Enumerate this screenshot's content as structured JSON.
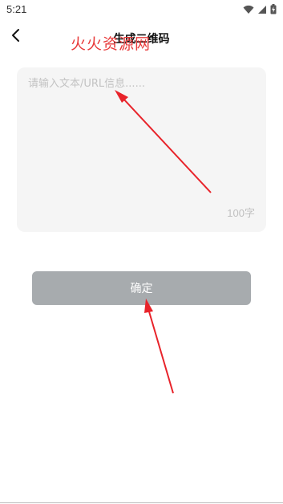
{
  "status_bar": {
    "time": "5:21",
    "icons": [
      "wifi-icon",
      "signal-icon",
      "battery-charging-icon"
    ]
  },
  "header": {
    "back_icon": "chevron-left-icon",
    "title": "生成二维码"
  },
  "watermark": "火火资源网",
  "input": {
    "placeholder": "请输入文本/URL信息......",
    "value": "",
    "char_limit": "100字"
  },
  "confirm_button": {
    "label": "确定"
  },
  "colors": {
    "button_disabled": "#a7abae",
    "input_background": "#f5f5f5",
    "annotation_red": "#e8232a"
  }
}
